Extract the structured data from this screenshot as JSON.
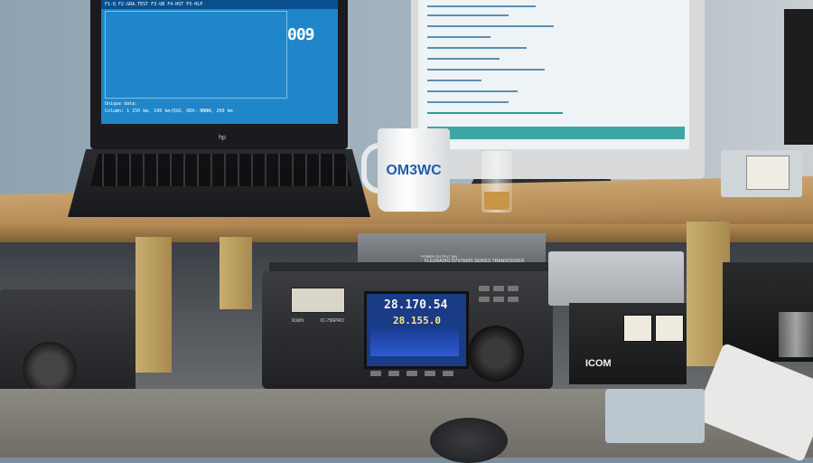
{
  "laptop": {
    "brand": "hp",
    "screen_counter": "009",
    "screen_line_top": "F1-Q F2-GRA.TEST F3-UB F4-HST F5-HLP",
    "screen_line_mid": "Unique data:",
    "screen_line_bottom": "Column: 1 150 km, 100 km/QSO, ODX: NNNW, 200 km"
  },
  "mug": {
    "label": "OM3WC"
  },
  "flex": {
    "label": "FLEXRADIO SYSTEMS SERIES TRANSCEIVER",
    "power": "POWER OUTPUT (W)"
  },
  "icom_radio": {
    "brand": "Icom",
    "model": "IC-756PRO",
    "frequency_main": "28.170.54",
    "frequency_sub": "28.155.0"
  },
  "psu": {
    "brand": "ICOM"
  },
  "colors": {
    "laptop_screen": "#1f86c9",
    "rig_screen": "#1a3b86",
    "mug_text": "#1f5ea8"
  }
}
